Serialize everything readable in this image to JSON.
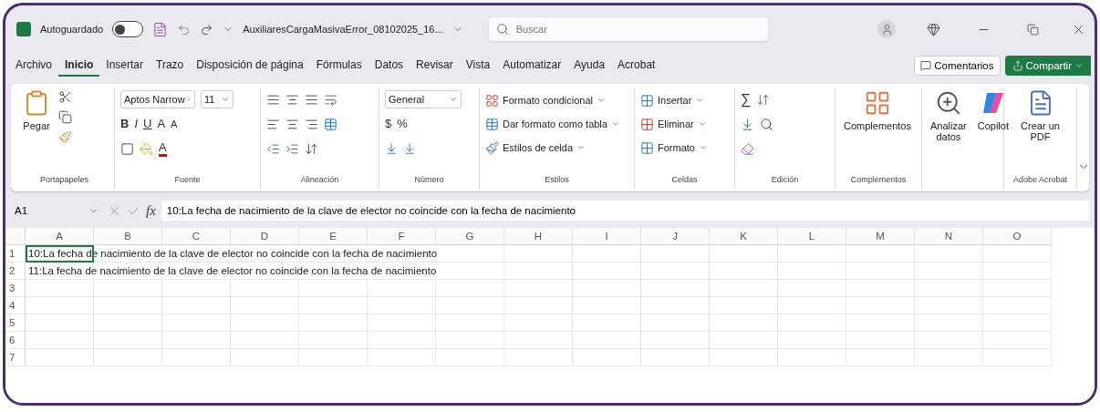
{
  "title_bar": {
    "autosave_label": "Autoguardado",
    "autosave_on": false,
    "file_name": "AuxiliaresCargaMasivaError_08102025_16...",
    "search_placeholder": "Buscar"
  },
  "menu_tabs": [
    {
      "label": "Archivo",
      "selected": false
    },
    {
      "label": "Inicio",
      "selected": true
    },
    {
      "label": "Insertar",
      "selected": false
    },
    {
      "label": "Trazo",
      "selected": false
    },
    {
      "label": "Disposición de página",
      "selected": false
    },
    {
      "label": "Fórmulas",
      "selected": false
    },
    {
      "label": "Datos",
      "selected": false
    },
    {
      "label": "Revisar",
      "selected": false
    },
    {
      "label": "Vista",
      "selected": false
    },
    {
      "label": "Automatizar",
      "selected": false
    },
    {
      "label": "Ayuda",
      "selected": false
    },
    {
      "label": "Acrobat",
      "selected": false
    }
  ],
  "comments_button": "Comentarios",
  "share_button": "Compartir",
  "ribbon": {
    "groups": [
      {
        "kind": "clipboard",
        "label": "Portapapeles",
        "paste": "Pegar"
      },
      {
        "kind": "font",
        "label": "Fuente",
        "font": "Aptos Narrow",
        "size": "11",
        "bold": "B",
        "italic": "I",
        "underline": "U",
        "grow": "A",
        "shrink": "A",
        "font_color": "A"
      },
      {
        "kind": "alignment",
        "label": "Alineación"
      },
      {
        "kind": "number",
        "label": "Número",
        "format": "General",
        "currency": "$",
        "percent": "%"
      },
      {
        "kind": "list",
        "label": "Estilos",
        "items": [
          {
            "label": "Formato condicional"
          },
          {
            "label": "Dar formato como tabla"
          },
          {
            "label": "Estilos de celda"
          }
        ]
      },
      {
        "kind": "list",
        "label": "Celdas",
        "items": [
          {
            "label": "Insertar"
          },
          {
            "label": "Eliminar"
          },
          {
            "label": "Formato"
          }
        ]
      },
      {
        "kind": "editing",
        "label": "Edición",
        "sum": "∑"
      },
      {
        "kind": "large",
        "label": "Complementos",
        "buttons": [
          {
            "label": "Complementos"
          }
        ]
      },
      {
        "kind": "large",
        "buttons": [
          {
            "label": "Analizar datos"
          },
          {
            "label": "Copilot"
          }
        ]
      },
      {
        "kind": "large",
        "label": "Adobe Acrobat",
        "buttons": [
          {
            "label": "Crear un PDF"
          }
        ]
      }
    ]
  },
  "formula_bar": {
    "name_box": "A1",
    "fx": "fx",
    "content": "10:La fecha de nacimiento de la clave de elector no coincide con la fecha de nacimiento"
  },
  "sheet": {
    "columns": [
      "A",
      "B",
      "C",
      "D",
      "E",
      "F",
      "G",
      "H",
      "I",
      "J",
      "K",
      "L",
      "M",
      "N",
      "O"
    ],
    "rows": [
      {
        "number": "1",
        "cell_a": "10:La fecha de nacimiento de la clave de elector no coincide con la fecha de nacimiento",
        "selected": true
      },
      {
        "number": "2",
        "cell_a": "11:La fecha de nacimiento de la clave de elector no coincide con la fecha de nacimiento",
        "selected": false
      },
      {
        "number": "3",
        "selected": false
      },
      {
        "number": "4",
        "selected": false
      },
      {
        "number": "5",
        "selected": false
      },
      {
        "number": "6",
        "selected": false
      },
      {
        "number": "7",
        "selected": false
      }
    ]
  }
}
